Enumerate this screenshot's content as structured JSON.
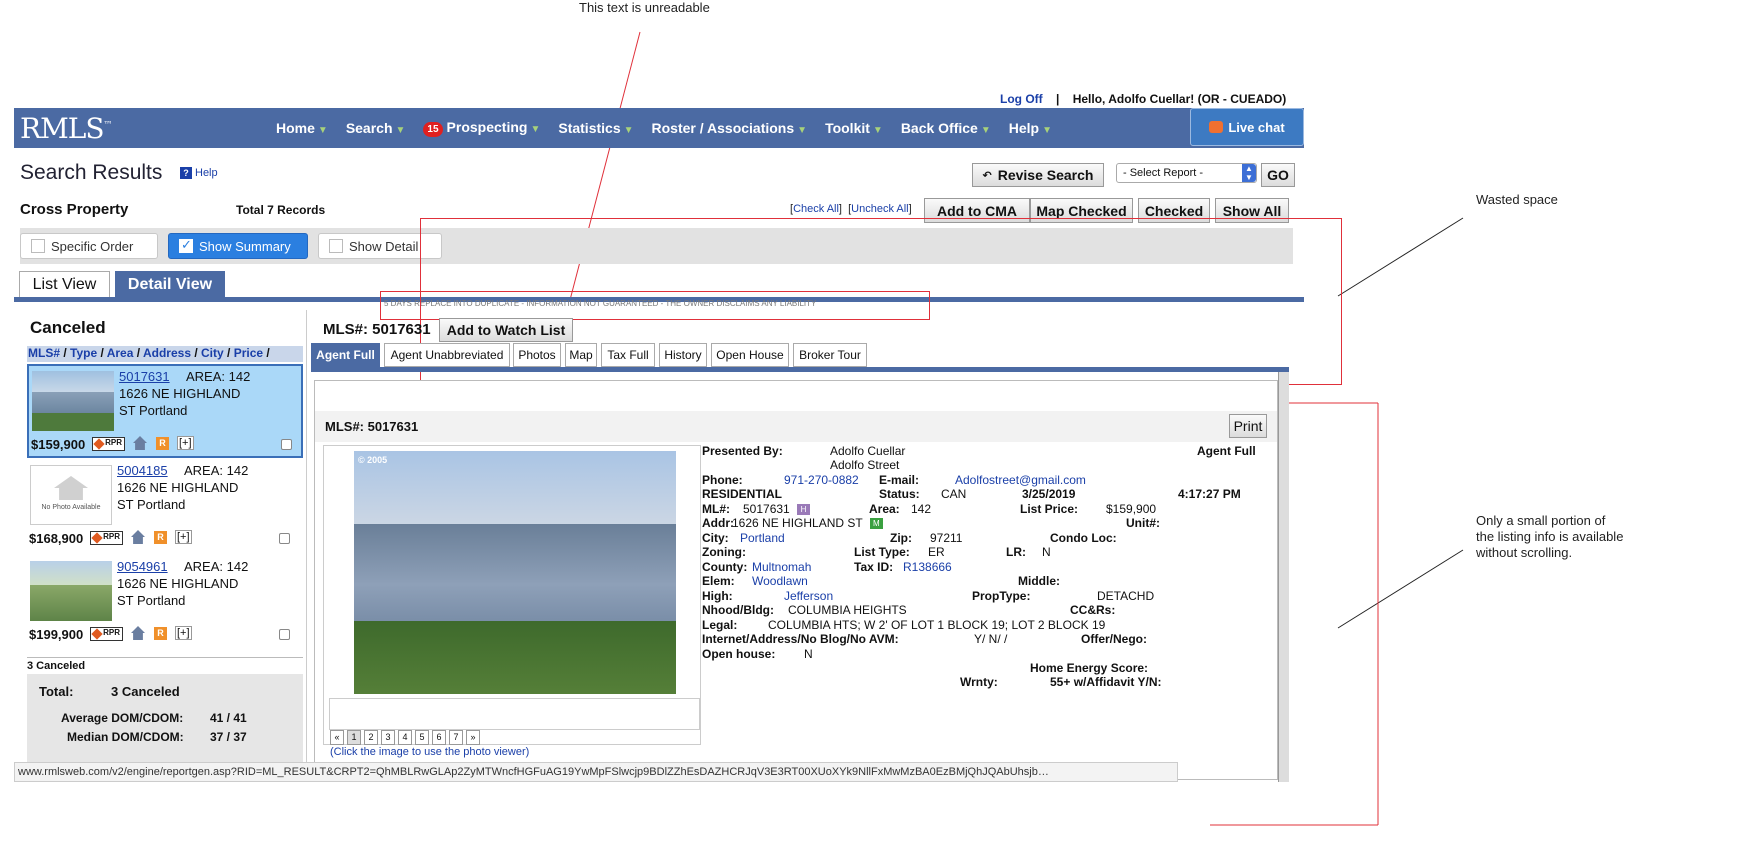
{
  "annotations": {
    "unreadable": "This text is unreadable",
    "wasted": "Wasted space",
    "small_portion": "Only a small portion of the listing info is available without scrolling."
  },
  "user": {
    "logoff": "Log Off",
    "separator": "|",
    "greeting": "Hello, Adolfo Cuellar! (OR - CUEADO)"
  },
  "nav": {
    "logo": "RMLS",
    "logo_mark": "™",
    "items": [
      "Home",
      "Search",
      "Prospecting",
      "Statistics",
      "Roster / Associations",
      "Toolkit",
      "Back Office",
      "Help"
    ],
    "prospecting_badge": "15",
    "live_chat": "Live chat"
  },
  "page": {
    "title": "Search Results",
    "help": "Help"
  },
  "toolbar": {
    "revise": "Revise Search",
    "select_report": "- Select Report -",
    "go": "GO",
    "cross_property": "Cross Property",
    "total_records": "Total 7 Records",
    "check_all": "Check All",
    "uncheck_all": "Uncheck All",
    "add_cma": "Add to CMA",
    "map_checked": "Map Checked",
    "checked": "Checked",
    "show_all": "Show All"
  },
  "toggles": {
    "specific_order": "Specific Order",
    "show_summary": "Show Summary",
    "show_detail": "Show Detail"
  },
  "views": {
    "list": "List View",
    "detail": "Detail View"
  },
  "unreadable_line": "5 DAYS REPLACE INTO DUPLICATE - INFORMATION NOT GUARANTEED - THE OWNER DISCLAIMS ANY LIABILITY",
  "list": {
    "title": "Canceled",
    "sort": [
      "MLS#",
      "Type",
      "Area",
      "Address",
      "City",
      "Price"
    ],
    "items": [
      {
        "mls": "5017631",
        "area": "AREA: 142",
        "addr1": "1626 NE HIGHLAND",
        "addr2": "ST Portland",
        "price": "$159,900"
      },
      {
        "mls": "5004185",
        "area": "AREA: 142",
        "addr1": "1626 NE HIGHLAND",
        "addr2": "ST Portland",
        "price": "$168,900"
      },
      {
        "mls": "9054961",
        "area": "AREA: 142",
        "addr1": "1626 NE HIGHLAND",
        "addr2": "ST Portland",
        "price": "$199,900"
      }
    ],
    "rpr": "RPR",
    "r_icon": "R",
    "plus": "[+]",
    "no_photo": "No Photo Available",
    "count": "3 Canceled",
    "total_label": "Total:",
    "total_value": "3 Canceled",
    "avg_label": "Average DOM/CDOM:",
    "avg_value": "41 / 41",
    "med_label": "Median DOM/CDOM:",
    "med_value": "37 / 37"
  },
  "detail": {
    "mls_header": "MLS#: 5017631",
    "watch": "Add to Watch List",
    "tabs": [
      "Agent Full",
      "Agent Unabbreviated",
      "Photos",
      "Map",
      "Tax Full",
      "History",
      "Open House",
      "Broker Tour"
    ],
    "card_mls": "MLS#: 5017631",
    "print": "Print",
    "photo_year": "© 2005",
    "pager": [
      "«",
      "1",
      "2",
      "3",
      "4",
      "5",
      "6",
      "7",
      "»"
    ],
    "viewer_hint": "(Click the image to use the photo viewer)"
  },
  "info": {
    "presented_by_l": "Presented By:",
    "presented_by_v1": "Adolfo Cuellar",
    "presented_by_v2": "Adolfo Street",
    "agent_full": "Agent Full",
    "phone_l": "Phone:",
    "phone_v": "971-270-0882",
    "email_l": "E-mail:",
    "email_v": "Adolfostreet@gmail.com",
    "residential": "RESIDENTIAL",
    "status_l": "Status:",
    "status_v": "CAN",
    "date": "3/25/2019",
    "time": "4:17:27 PM",
    "ml_l": "ML#:",
    "ml_v": "5017631",
    "h_badge": "H",
    "area_l": "Area:",
    "area_v": "142",
    "listprice_l": "List Price:",
    "listprice_v": "$159,900",
    "addr_l": "Addr:",
    "addr_v": "1626 NE HIGHLAND ST",
    "m_badge": "M",
    "unit_l": "Unit#:",
    "city_l": "City:",
    "city_v": "Portland",
    "zip_l": "Zip:",
    "zip_v": "97211",
    "condo_l": "Condo Loc:",
    "zoning_l": "Zoning:",
    "listtype_l": "List Type:",
    "listtype_v": "ER",
    "lr_l": "LR:",
    "lr_v": "N",
    "county_l": "County:",
    "county_v": "Multnomah",
    "taxid_l": "Tax ID:",
    "taxid_v": "R138666",
    "elem_l": "Elem:",
    "elem_v": "Woodlawn",
    "middle_l": "Middle:",
    "high_l": "High:",
    "high_v": "Jefferson",
    "proptype_l": "PropType:",
    "proptype_v": "DETACHD",
    "nhood_l": "Nhood/Bldg:",
    "nhood_v": "COLUMBIA HEIGHTS",
    "ccrs_l": "CC&Rs:",
    "legal_l": "Legal:",
    "legal_v": "COLUMBIA HTS; W 2' OF LOT 1 BLOCK 19; LOT 2 BLOCK 19",
    "internet_l": "Internet/Address/No Blog/No AVM:",
    "internet_v": "Y/ N/ /",
    "offer_l": "Offer/Nego:",
    "openhouse_l": "Open house:",
    "openhouse_v": "N",
    "energy_l": "Home Energy Score:",
    "wrnty_l": "Wrnty:",
    "affidavit_l": "55+ w/Affidavit Y/N:"
  },
  "status_url": "www.rmlsweb.com/v2/engine/reportgen.asp?RID=ML_RESULT&CRPT2=QhMBLRwGLAp2ZyMTWncfHGFuAG19YwMpFSlwcjp9BDlZZhEsDAZHCRJqV3E3RT00XUoXYk9NllFxMwMzBA0EzBMjQhJQAbUhsjb…"
}
